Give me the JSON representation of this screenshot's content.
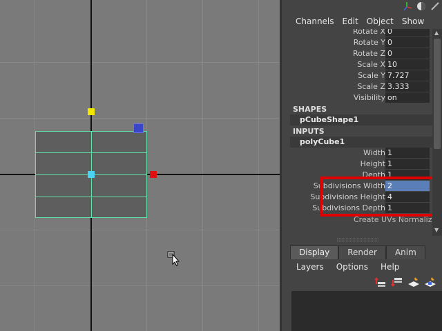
{
  "viewport": {
    "label": "3D viewport"
  },
  "channel_box": {
    "menu": [
      "Channels",
      "Edit",
      "Object",
      "Show"
    ],
    "transform_attrs": [
      {
        "label": "Rotate X",
        "value": "0"
      },
      {
        "label": "Rotate Y",
        "value": "0"
      },
      {
        "label": "Rotate Z",
        "value": "0"
      },
      {
        "label": "Scale X",
        "value": "10"
      },
      {
        "label": "Scale Y",
        "value": "7.727"
      },
      {
        "label": "Scale Z",
        "value": "3.333"
      },
      {
        "label": "Visibility",
        "value": "on"
      }
    ],
    "shapes_header": "SHAPES",
    "shape_node": "pCubeShape1",
    "inputs_header": "INPUTS",
    "input_node": "polyCube1",
    "input_attrs": [
      {
        "label": "Width",
        "value": "1"
      },
      {
        "label": "Height",
        "value": "1"
      },
      {
        "label": "Depth",
        "value": "1"
      },
      {
        "label": "Subdivisions Width",
        "value": "2",
        "selected": true
      },
      {
        "label": "Subdivisions Height",
        "value": "4"
      },
      {
        "label": "Subdivisions Depth",
        "value": "1"
      }
    ],
    "create_uvs_label": "Create UVs Normalize ..."
  },
  "layer_editor": {
    "tabs": [
      "Display",
      "Render",
      "Anim"
    ],
    "active_tab": "Display",
    "menu": [
      "Layers",
      "Options",
      "Help"
    ]
  },
  "colors": {
    "highlight": "#e00000",
    "wireframe": "#5fe0a8",
    "selected_value": "#5a7fb8"
  }
}
